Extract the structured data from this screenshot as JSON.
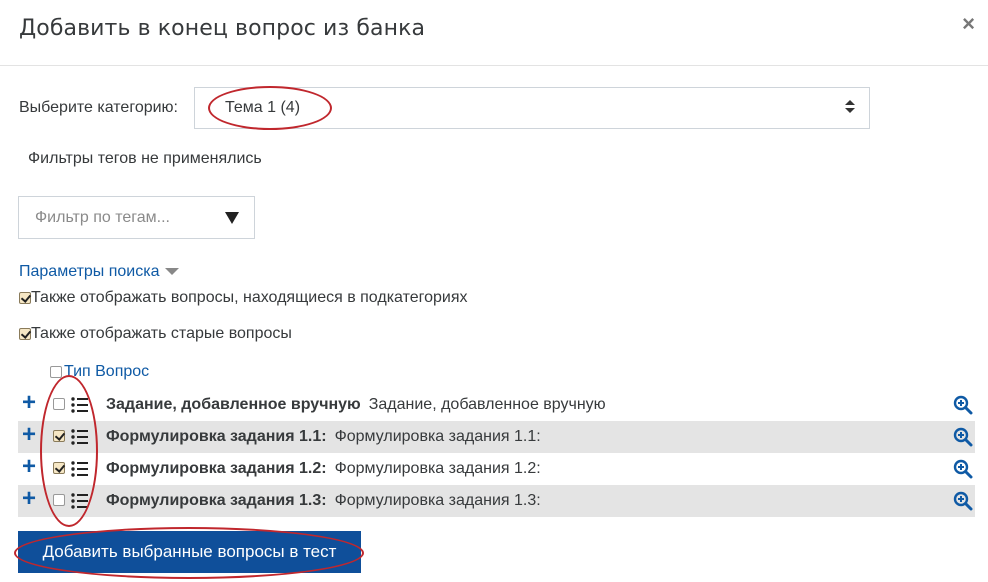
{
  "dialog": {
    "title": "Добавить в конец вопрос из банка",
    "close_label": "×"
  },
  "category": {
    "label": "Выберите категорию:",
    "selected": "Тема 1 (4)"
  },
  "tag_filter": {
    "note": "Фильтры тегов не применялись",
    "placeholder": "Фильтр по тегам..."
  },
  "search_params": {
    "label": "Параметры поиска",
    "options": [
      {
        "label": "Также отображать вопросы, находящиеся в подкатегориях",
        "checked": true
      },
      {
        "label": "Также отображать старые вопросы",
        "checked": true
      }
    ]
  },
  "table": {
    "col_type": "Тип",
    "col_question": "Вопрос",
    "rows": [
      {
        "name": "Задание, добавленное вручную",
        "text": "Задание, добавленное вручную",
        "checked": false
      },
      {
        "name": "Формулировка задания 1.1:",
        "text": "Формулировка задания 1.1:",
        "checked": true
      },
      {
        "name": "Формулировка задания 1.2:",
        "text": "Формулировка задания 1.2:",
        "checked": true
      },
      {
        "name": "Формулировка задания 1.3:",
        "text": "Формулировка задания 1.3:",
        "checked": false
      }
    ]
  },
  "add_button_label": "Добавить выбранные вопросы в тест",
  "colors": {
    "accent": "#0f5aa5",
    "button": "#0f4f9a",
    "annotation": "#c0272d"
  },
  "icons": {
    "add": "plus-icon",
    "type": "multichoice-list-icon",
    "preview": "zoom-in-icon",
    "close": "close-icon"
  }
}
